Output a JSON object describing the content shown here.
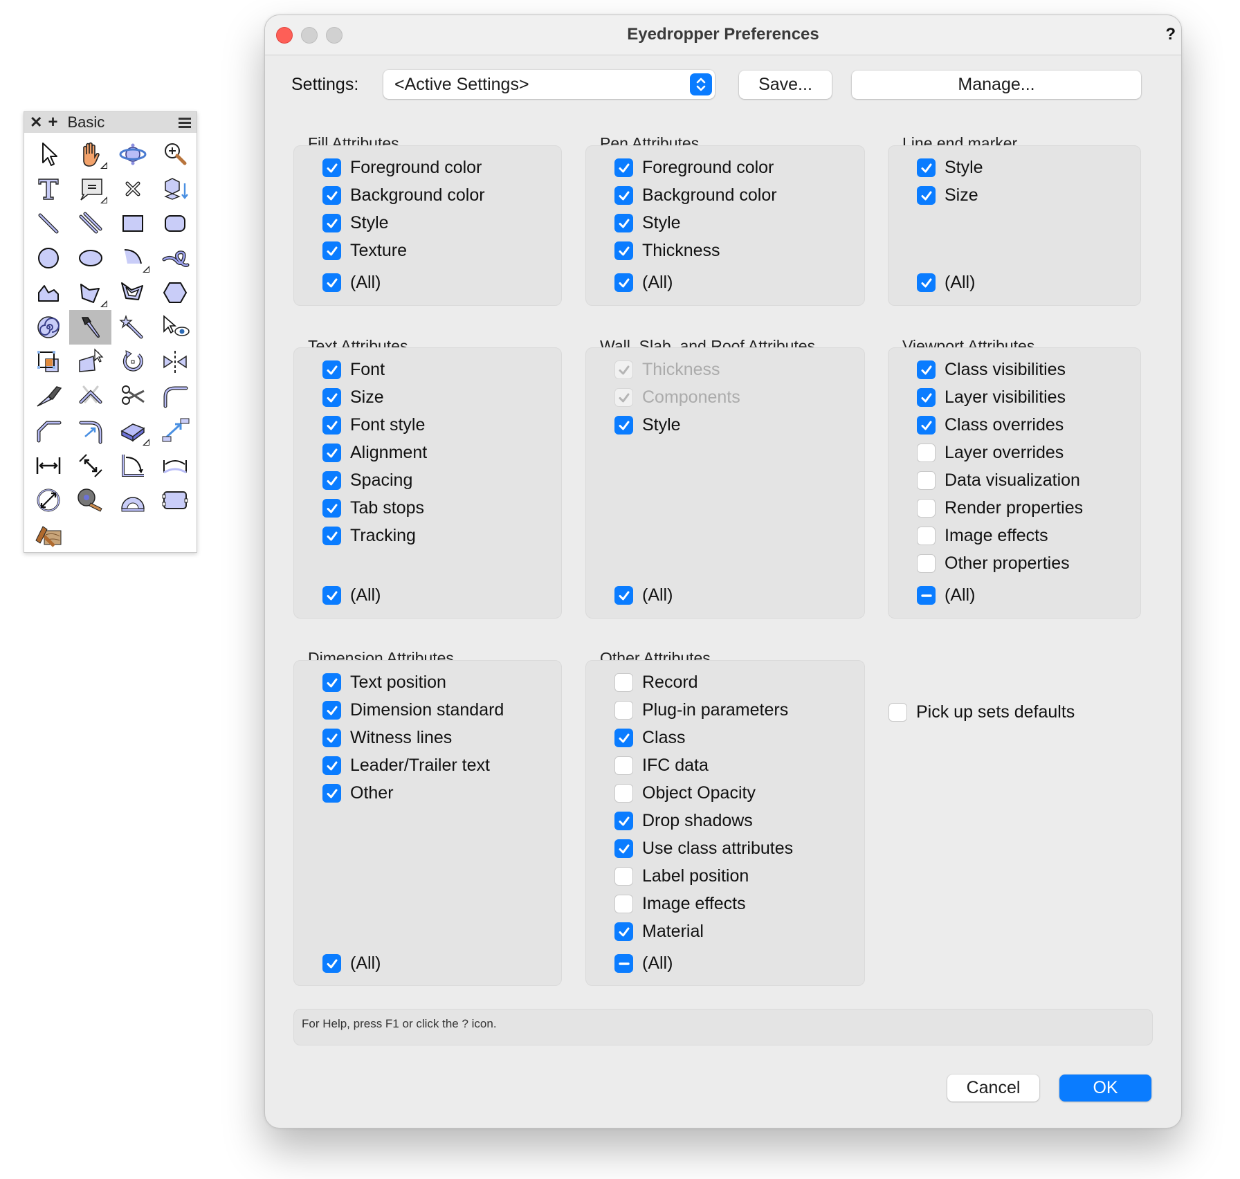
{
  "palette": {
    "title": "Basic",
    "close_icon": "close-icon",
    "add_icon": "plus-icon",
    "menu_icon": "hamburger-menu-icon",
    "tools": [
      {
        "name": "selection-tool",
        "icon": "arrow-pointer-icon",
        "has_submenu": false,
        "selected": false
      },
      {
        "name": "pan-tool",
        "icon": "hand-icon",
        "has_submenu": true,
        "selected": false
      },
      {
        "name": "flyover-tool",
        "icon": "orbit-icon",
        "has_submenu": false,
        "selected": false
      },
      {
        "name": "zoom-tool",
        "icon": "magnifier-plus-icon",
        "has_submenu": false,
        "selected": false
      },
      {
        "name": "text-tool",
        "icon": "text-t-icon",
        "has_submenu": false,
        "selected": false
      },
      {
        "name": "callout-tool",
        "icon": "speech-bubble-icon",
        "has_submenu": true,
        "selected": false
      },
      {
        "name": "locus-tool",
        "icon": "x-mark-icon",
        "has_submenu": false,
        "selected": false
      },
      {
        "name": "3d-locus-tool",
        "icon": "cube-arrow-down-icon",
        "has_submenu": false,
        "selected": false
      },
      {
        "name": "line-tool",
        "icon": "line-icon",
        "has_submenu": false,
        "selected": false
      },
      {
        "name": "double-line-tool",
        "icon": "double-line-icon",
        "has_submenu": false,
        "selected": false
      },
      {
        "name": "rectangle-tool",
        "icon": "rectangle-icon",
        "has_submenu": false,
        "selected": false
      },
      {
        "name": "rounded-rectangle-tool",
        "icon": "rounded-rectangle-icon",
        "has_submenu": false,
        "selected": false
      },
      {
        "name": "circle-tool",
        "icon": "circle-icon",
        "has_submenu": false,
        "selected": false
      },
      {
        "name": "oval-tool",
        "icon": "oval-icon",
        "has_submenu": false,
        "selected": false
      },
      {
        "name": "arc-tool",
        "icon": "arc-icon",
        "has_submenu": true,
        "selected": false
      },
      {
        "name": "freehand-tool",
        "icon": "freehand-loop-icon",
        "has_submenu": false,
        "selected": false
      },
      {
        "name": "polyline-tool",
        "icon": "polyline-icon",
        "has_submenu": false,
        "selected": false
      },
      {
        "name": "polygon-tool",
        "icon": "polygon-icon",
        "has_submenu": true,
        "selected": false
      },
      {
        "name": "double-polygon-tool",
        "icon": "double-polygon-icon",
        "has_submenu": false,
        "selected": false
      },
      {
        "name": "regular-polygon-tool",
        "icon": "hexagon-icon",
        "has_submenu": false,
        "selected": false
      },
      {
        "name": "spiral-tool",
        "icon": "spiral-icon",
        "has_submenu": false,
        "selected": false
      },
      {
        "name": "eyedropper-tool",
        "icon": "eyedropper-icon",
        "has_submenu": false,
        "selected": true
      },
      {
        "name": "attribute-mapping-tool",
        "icon": "magic-wand-icon",
        "has_submenu": false,
        "selected": false
      },
      {
        "name": "visibility-tool",
        "icon": "pointer-eye-icon",
        "has_submenu": false,
        "selected": false
      },
      {
        "name": "offset-tool",
        "icon": "offset-squares-icon",
        "has_submenu": false,
        "selected": false
      },
      {
        "name": "reshape-tool",
        "icon": "reshape-icon",
        "has_submenu": false,
        "selected": false
      },
      {
        "name": "rotate-tool",
        "icon": "rotate-icon",
        "has_submenu": false,
        "selected": false
      },
      {
        "name": "mirror-tool",
        "icon": "mirror-icon",
        "has_submenu": false,
        "selected": false
      },
      {
        "name": "split-tool",
        "icon": "knife-icon",
        "has_submenu": false,
        "selected": false
      },
      {
        "name": "connect-combine-tool",
        "icon": "connect-lines-icon",
        "has_submenu": false,
        "selected": false
      },
      {
        "name": "trim-tool",
        "icon": "scissors-icon",
        "has_submenu": false,
        "selected": false
      },
      {
        "name": "fillet-tool",
        "icon": "fillet-icon",
        "has_submenu": false,
        "selected": false
      },
      {
        "name": "chamfer-tool",
        "icon": "chamfer-icon",
        "has_submenu": false,
        "selected": false
      },
      {
        "name": "offset-path-tool",
        "icon": "fillet-arrow-icon",
        "has_submenu": false,
        "selected": false
      },
      {
        "name": "clip-tool",
        "icon": "eraser-icon",
        "has_submenu": true,
        "selected": false
      },
      {
        "name": "move-by-points-tool",
        "icon": "move-arrow-icon",
        "has_submenu": false,
        "selected": false
      },
      {
        "name": "dimension-tool",
        "icon": "dimension-horizontal-icon",
        "has_submenu": false,
        "selected": false
      },
      {
        "name": "aligned-dimension-tool",
        "icon": "dimension-diagonal-icon",
        "has_submenu": false,
        "selected": false
      },
      {
        "name": "angular-dimension-tool",
        "icon": "angle-dimension-icon",
        "has_submenu": false,
        "selected": false
      },
      {
        "name": "arc-length-dimension-tool",
        "icon": "arc-dimension-icon",
        "has_submenu": false,
        "selected": false
      },
      {
        "name": "radial-dimension-tool",
        "icon": "radial-dimension-icon",
        "has_submenu": false,
        "selected": false
      },
      {
        "name": "tape-measure-tool",
        "icon": "tape-measure-icon",
        "has_submenu": false,
        "selected": false
      },
      {
        "name": "protractor-tool",
        "icon": "protractor-icon",
        "has_submenu": false,
        "selected": false
      },
      {
        "name": "symbol-insertion-tool",
        "icon": "rounded-box-connector-icon",
        "has_submenu": false,
        "selected": false
      },
      {
        "name": "texture-bed-tool",
        "icon": "paint-roller-wood-icon",
        "has_submenu": false,
        "selected": false
      }
    ]
  },
  "dialog": {
    "title": "Eyedropper Preferences",
    "help_button": "?",
    "settings_label": "Settings:",
    "settings_value": "<Active Settings>",
    "save_button": "Save...",
    "manage_button": "Manage...",
    "groups": {
      "fill": {
        "label": "Fill Attributes",
        "items": [
          {
            "label": "Foreground color",
            "state": "checked"
          },
          {
            "label": "Background color",
            "state": "checked"
          },
          {
            "label": "Style",
            "state": "checked"
          },
          {
            "label": "Texture",
            "state": "checked"
          }
        ],
        "all": {
          "label": "(All)",
          "state": "checked"
        }
      },
      "pen": {
        "label": "Pen Attributes",
        "items": [
          {
            "label": "Foreground color",
            "state": "checked"
          },
          {
            "label": "Background color",
            "state": "checked"
          },
          {
            "label": "Style",
            "state": "checked"
          },
          {
            "label": "Thickness",
            "state": "checked"
          }
        ],
        "all": {
          "label": "(All)",
          "state": "checked"
        }
      },
      "line_end": {
        "label": "Line end marker",
        "items": [
          {
            "label": "Style",
            "state": "checked"
          },
          {
            "label": "Size",
            "state": "checked"
          }
        ],
        "all": {
          "label": "(All)",
          "state": "checked"
        }
      },
      "text": {
        "label": "Text Attributes",
        "items": [
          {
            "label": "Font",
            "state": "checked"
          },
          {
            "label": "Size",
            "state": "checked"
          },
          {
            "label": "Font style",
            "state": "checked"
          },
          {
            "label": "Alignment",
            "state": "checked"
          },
          {
            "label": "Spacing",
            "state": "checked"
          },
          {
            "label": "Tab stops",
            "state": "checked"
          },
          {
            "label": "Tracking",
            "state": "checked"
          }
        ],
        "all": {
          "label": "(All)",
          "state": "checked"
        }
      },
      "wall": {
        "label": "Wall, Slab, and Roof Attributes",
        "items": [
          {
            "label": "Thickness",
            "state": "checked-disabled"
          },
          {
            "label": "Components",
            "state": "checked-disabled"
          },
          {
            "label": "Style",
            "state": "checked"
          }
        ],
        "all": {
          "label": "(All)",
          "state": "checked"
        }
      },
      "viewport": {
        "label": "Viewport Attributes",
        "items": [
          {
            "label": "Class visibilities",
            "state": "checked"
          },
          {
            "label": "Layer visibilities",
            "state": "checked"
          },
          {
            "label": "Class overrides",
            "state": "checked"
          },
          {
            "label": "Layer overrides",
            "state": "unchecked"
          },
          {
            "label": "Data visualization",
            "state": "unchecked"
          },
          {
            "label": "Render properties",
            "state": "unchecked"
          },
          {
            "label": "Image effects",
            "state": "unchecked"
          },
          {
            "label": "Other properties",
            "state": "unchecked"
          }
        ],
        "all": {
          "label": "(All)",
          "state": "mixed"
        }
      },
      "dimension": {
        "label": "Dimension Attributes",
        "items": [
          {
            "label": "Text position",
            "state": "checked"
          },
          {
            "label": "Dimension standard",
            "state": "checked"
          },
          {
            "label": "Witness lines",
            "state": "checked"
          },
          {
            "label": "Leader/Trailer text",
            "state": "checked"
          },
          {
            "label": "Other",
            "state": "checked"
          }
        ],
        "all": {
          "label": "(All)",
          "state": "checked"
        }
      },
      "other": {
        "label": "Other Attributes",
        "items": [
          {
            "label": "Record",
            "state": "unchecked"
          },
          {
            "label": "Plug-in parameters",
            "state": "unchecked"
          },
          {
            "label": "Class",
            "state": "checked"
          },
          {
            "label": "IFC data",
            "state": "unchecked"
          },
          {
            "label": "Object Opacity",
            "state": "unchecked"
          },
          {
            "label": "Drop shadows",
            "state": "checked"
          },
          {
            "label": "Use class attributes",
            "state": "checked"
          },
          {
            "label": "Label position",
            "state": "unchecked"
          },
          {
            "label": "Image effects",
            "state": "unchecked"
          },
          {
            "label": "Material",
            "state": "checked"
          }
        ],
        "all": {
          "label": "(All)",
          "state": "mixed"
        }
      }
    },
    "pickup_defaults": {
      "label": "Pick up sets defaults",
      "state": "unchecked"
    },
    "help_text": "For Help, press F1 or click the ? icon.",
    "cancel_button": "Cancel",
    "ok_button": "OK",
    "colors": {
      "accent": "#0a7cff",
      "close_light": "#fe5f57",
      "window_bg": "#ececec",
      "group_bg": "#e4e4e4"
    }
  }
}
